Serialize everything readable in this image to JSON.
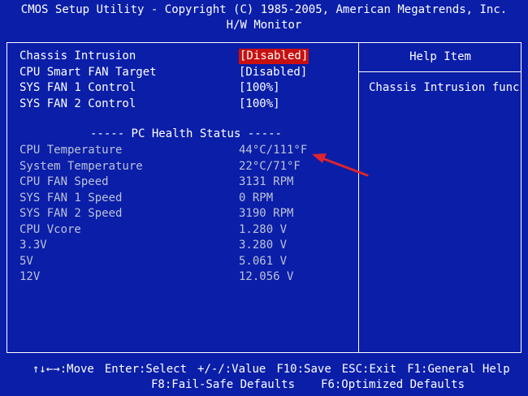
{
  "header": {
    "title": "CMOS Setup Utility - Copyright (C) 1985-2005, American Megatrends, Inc.",
    "subtitle": "H/W Monitor"
  },
  "settings": [
    {
      "label": "Chassis Intrusion",
      "value": "[Disabled]",
      "selected": true
    },
    {
      "label": "CPU Smart FAN Target",
      "value": "[Disabled]",
      "selected": false
    },
    {
      "label": "SYS FAN 1 Control",
      "value": "[100%]",
      "selected": false
    },
    {
      "label": "SYS FAN 2 Control",
      "value": "[100%]",
      "selected": false
    }
  ],
  "section_title": "----- PC Health Status -----",
  "health": [
    {
      "label": "CPU Temperature",
      "value": "44°C/111°F"
    },
    {
      "label": "System Temperature",
      "value": "22°C/71°F"
    },
    {
      "label": "CPU FAN Speed",
      "value": "3131 RPM"
    },
    {
      "label": "SYS FAN 1 Speed",
      "value": "0 RPM"
    },
    {
      "label": "SYS FAN 2 Speed",
      "value": "3190 RPM"
    },
    {
      "label": "CPU Vcore",
      "value": "1.280 V"
    },
    {
      "label": "3.3V",
      "value": "3.280 V"
    },
    {
      "label": "5V",
      "value": "5.061 V"
    },
    {
      "label": "12V",
      "value": "12.056 V"
    }
  ],
  "help": {
    "title": "Help Item",
    "text": "Chassis Intrusion func"
  },
  "footer": {
    "line1": [
      "↑↓←→:Move",
      "Enter:Select",
      "+/-/:Value",
      "F10:Save",
      "ESC:Exit",
      "F1:General Help"
    ],
    "line2": [
      "F8:Fail-Safe Defaults",
      "F6:Optimized Defaults"
    ]
  },
  "colors": {
    "background": "#0a1ea8",
    "highlight": "#c81010",
    "text": "#ffffff",
    "readonly_text": "#bcc2d6",
    "arrow": "#e0242c"
  }
}
